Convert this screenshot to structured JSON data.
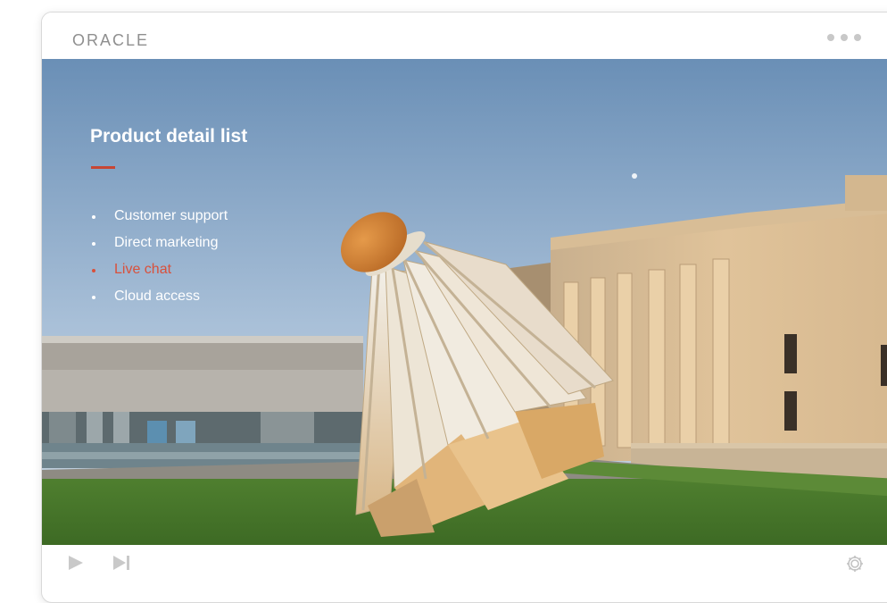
{
  "header": {
    "logo_text": "ORACLE"
  },
  "slide": {
    "title": "Product detail list",
    "accent_color": "#c74634",
    "bullets": [
      {
        "label": "Customer support",
        "active": false
      },
      {
        "label": "Direct marketing",
        "active": false
      },
      {
        "label": "Live chat",
        "active": true
      },
      {
        "label": "Cloud access",
        "active": false
      }
    ],
    "background_image": "museum-lawn-with-giant-shuttlecock-sculpture"
  },
  "controls": {
    "play_icon": "play-icon",
    "next_icon": "skip-next-icon",
    "settings_icon": "gear-icon",
    "more_icon": "more-dots-icon"
  }
}
